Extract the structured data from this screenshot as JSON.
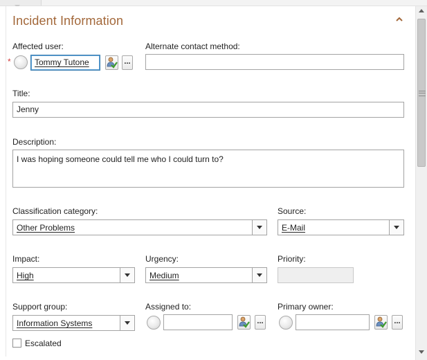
{
  "section": {
    "title": "Incident Information"
  },
  "affected_user": {
    "label": "Affected user:",
    "required_marker": "*",
    "value": "Tommy Tutone"
  },
  "alternate_contact": {
    "label": "Alternate contact method:",
    "value": ""
  },
  "title_field": {
    "label": "Title:",
    "value": "Jenny"
  },
  "description": {
    "label": "Description:",
    "value": "I was hoping someone could tell me who I could turn to?"
  },
  "classification": {
    "label": "Classification category:",
    "value": "Other Problems"
  },
  "source": {
    "label": "Source:",
    "value": "E-Mail"
  },
  "impact": {
    "label": "Impact:",
    "value": "High"
  },
  "urgency": {
    "label": "Urgency:",
    "value": "Medium"
  },
  "priority": {
    "label": "Priority:",
    "value": ""
  },
  "support_group": {
    "label": "Support group:",
    "value": "Information Systems"
  },
  "assigned_to": {
    "label": "Assigned to:",
    "value": ""
  },
  "primary_owner": {
    "label": "Primary owner:",
    "value": ""
  },
  "escalated": {
    "label": "Escalated",
    "checked": false
  },
  "buttons": {
    "ellipsis": "..."
  },
  "icons": {
    "collapse": "chevron-up-icon",
    "user_picker": "user-check-icon",
    "status": "status-radio-icon"
  },
  "colors": {
    "section_title": "#a3683a",
    "required": "#d23a3a",
    "focus_border": "#3c7fb1",
    "user_picker_green": "#3f9b2e"
  }
}
